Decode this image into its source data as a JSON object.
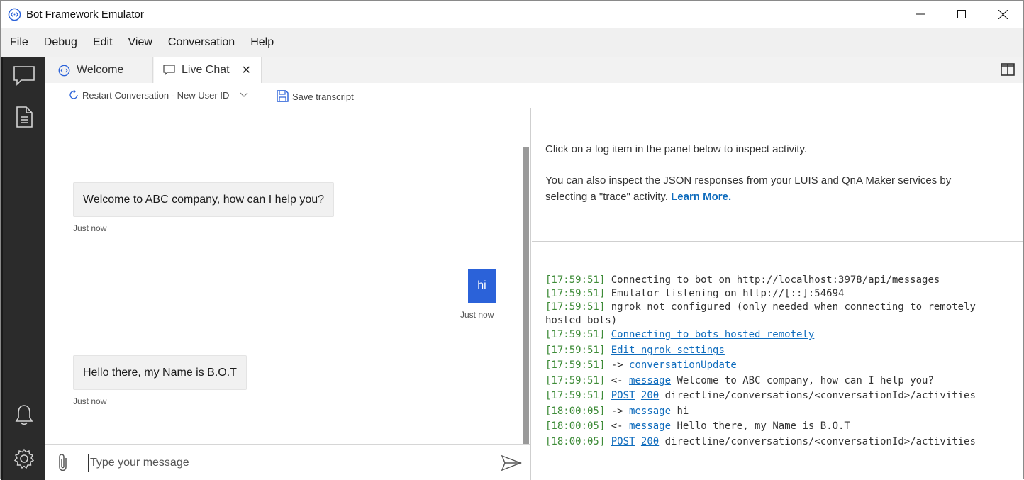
{
  "window": {
    "title": "Bot Framework Emulator"
  },
  "menu": {
    "items": [
      "File",
      "Debug",
      "Edit",
      "View",
      "Conversation",
      "Help"
    ]
  },
  "tabs": {
    "welcome": "Welcome",
    "livechat": "Live Chat",
    "close": "✕"
  },
  "toolbar": {
    "restart": "Restart Conversation - New User ID",
    "save": "Save transcript"
  },
  "chat": {
    "messages": [
      {
        "from": "bot",
        "text": "Welcome to ABC company, how can I help you?",
        "time": "Just now"
      },
      {
        "from": "user",
        "text": "hi",
        "time": "Just now"
      },
      {
        "from": "bot",
        "text": "Hello there, my Name is B.O.T",
        "time": "Just now"
      }
    ],
    "input_placeholder": "Type your message"
  },
  "inspector": {
    "line1": "Click on a log item in the panel below to inspect activity.",
    "line2": "You can also inspect the JSON responses from your LUIS and QnA Maker services by",
    "line3": "selecting a \"trace\" activity.",
    "learn_more": "Learn More."
  },
  "log": [
    {
      "time": "[17:59:51]",
      "text": " Connecting to bot on http://localhost:3978/api/messages"
    },
    {
      "time": "[17:59:51]",
      "text": " Emulator listening on http://[::]:54694"
    },
    {
      "time": "[17:59:51]",
      "text": " ngrok not configured (only needed when connecting to remotely"
    },
    {
      "time": "",
      "text": "hosted bots)"
    },
    {
      "time": "[17:59:51]",
      "link": "Connecting to bots hosted remotely"
    },
    {
      "time": "[17:59:51]",
      "link": "Edit ngrok settings"
    },
    {
      "time": "[17:59:51]",
      "prefix": "->",
      "link": "conversationUpdate"
    },
    {
      "time": "[17:59:51]",
      "prefix": "<-",
      "link": "message",
      "text": "Welcome to ABC company, how can I help you?"
    },
    {
      "time": "[17:59:51]",
      "link": "POST",
      "link2": "200",
      "text": "directline/conversations/<conversationId>/activities"
    },
    {
      "time": "[18:00:05]",
      "prefix": "->",
      "link": "message",
      "text": "hi"
    },
    {
      "time": "[18:00:05]",
      "prefix": "<-",
      "link": "message",
      "text": "Hello there, my Name is B.O.T"
    },
    {
      "time": "[18:00:05]",
      "link": "POST",
      "link2": "200",
      "text": "directline/conversations/<conversationId>/activities"
    }
  ]
}
